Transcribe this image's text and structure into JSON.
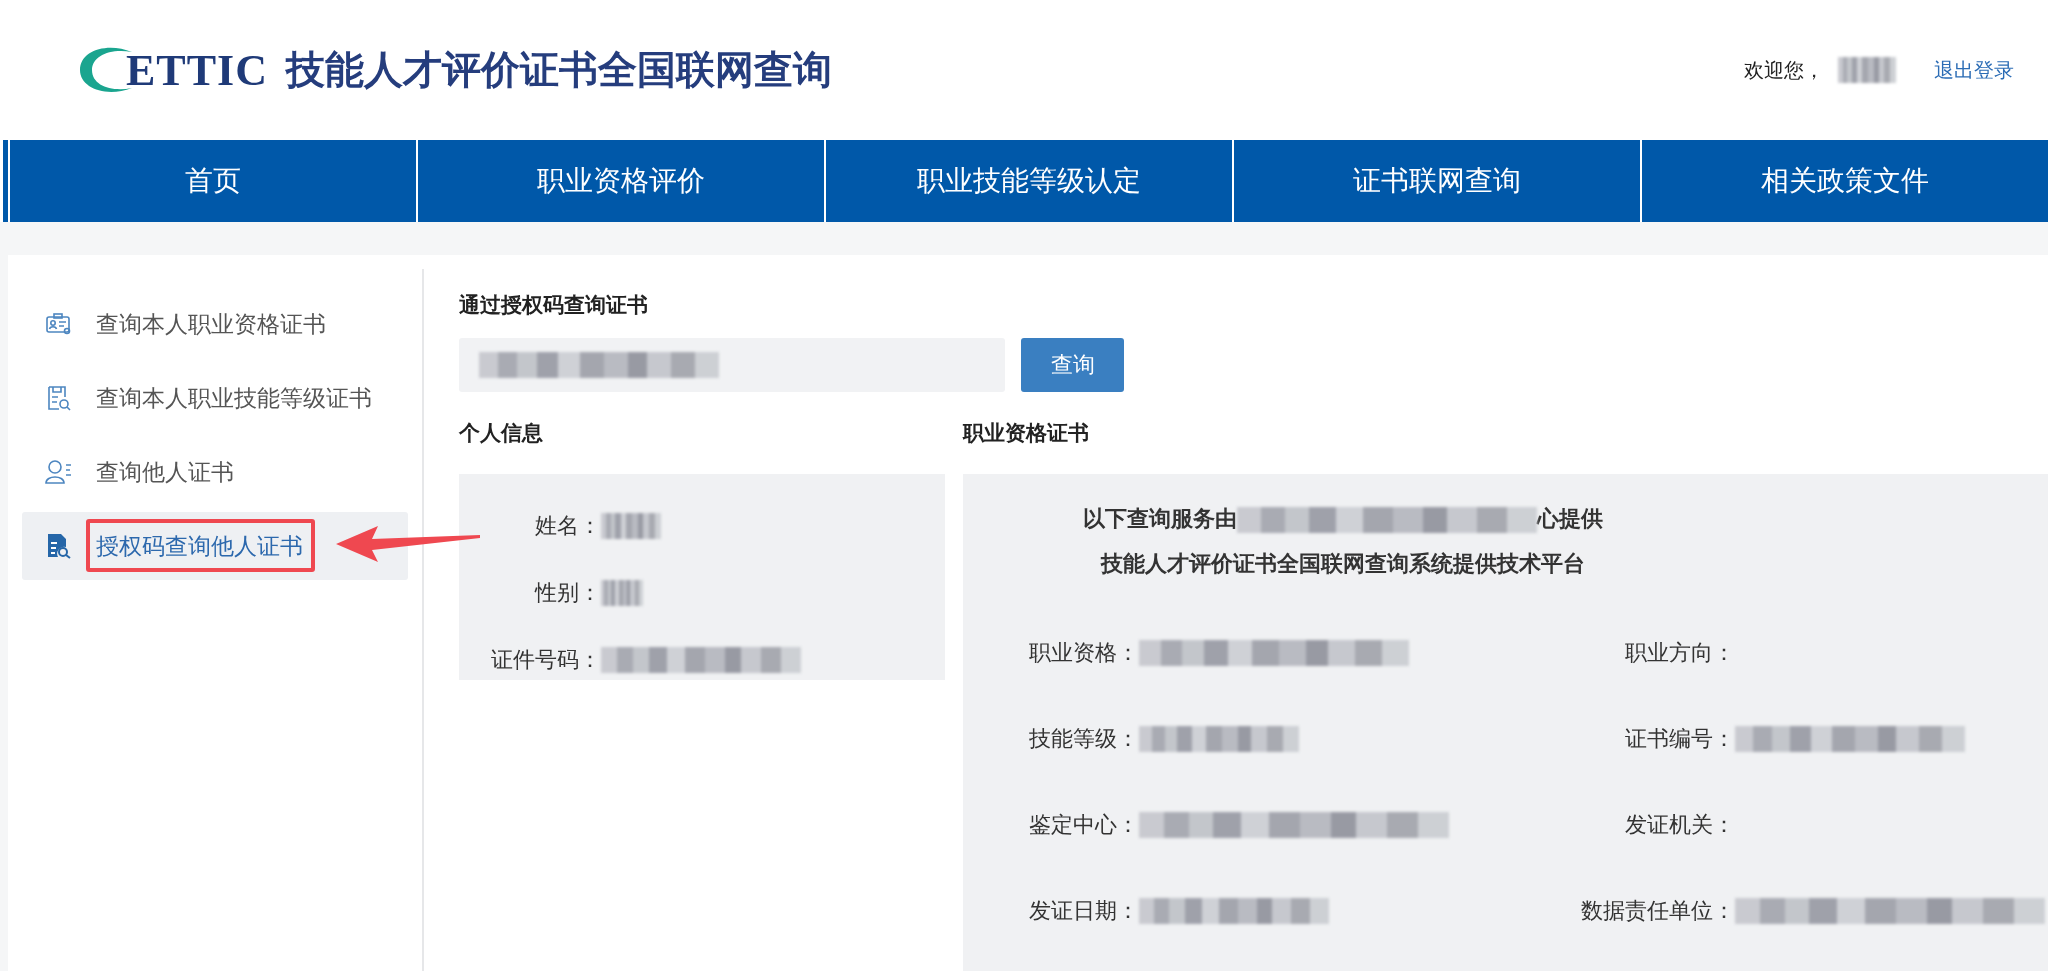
{
  "header": {
    "logo_text": "ETTIC",
    "title": "技能人才评价证书全国联网查询",
    "greeting": "欢迎您，",
    "user_redacted": true,
    "logout": "退出登录"
  },
  "nav": [
    {
      "label": "首页"
    },
    {
      "label": "职业资格评价"
    },
    {
      "label": "职业技能等级认定"
    },
    {
      "label": "证书联网查询"
    },
    {
      "label": "相关政策文件"
    }
  ],
  "sidebar": {
    "items": [
      {
        "label": "查询本人职业资格证书",
        "selected": false,
        "annotated": false
      },
      {
        "label": "查询本人职业技能等级证书",
        "selected": false,
        "annotated": false
      },
      {
        "label": "查询他人证书",
        "selected": false,
        "annotated": false
      },
      {
        "label": "授权码查询他人证书",
        "selected": true,
        "annotated": true
      }
    ]
  },
  "query": {
    "title": "通过授权码查询证书",
    "input_redacted": true,
    "button": "查询"
  },
  "personal": {
    "title": "个人信息",
    "fields": [
      {
        "label": "姓名：",
        "redacted": true
      },
      {
        "label": "性别：",
        "redacted": true
      },
      {
        "label": "证件号码：",
        "redacted": true
      }
    ]
  },
  "certificate": {
    "title": "职业资格证书",
    "notice": [
      {
        "before": "以下查询服务由",
        "redacted": true,
        "after": "心提供"
      },
      {
        "before": "技能人才评价证书全国联网查询系统提供技术平台",
        "redacted": false
      }
    ],
    "fields": [
      {
        "label": "职业资格：",
        "redacted": true
      },
      {
        "label": "职业方向：",
        "redacted": false
      },
      {
        "label": "技能等级：",
        "redacted": true
      },
      {
        "label": "证书编号：",
        "redacted": true
      },
      {
        "label": "鉴定中心：",
        "redacted": true
      },
      {
        "label": "发证机关：",
        "redacted": false
      },
      {
        "label": "发证日期：",
        "redacted": true
      },
      {
        "label": "数据责任单位：",
        "redacted": true
      }
    ]
  }
}
